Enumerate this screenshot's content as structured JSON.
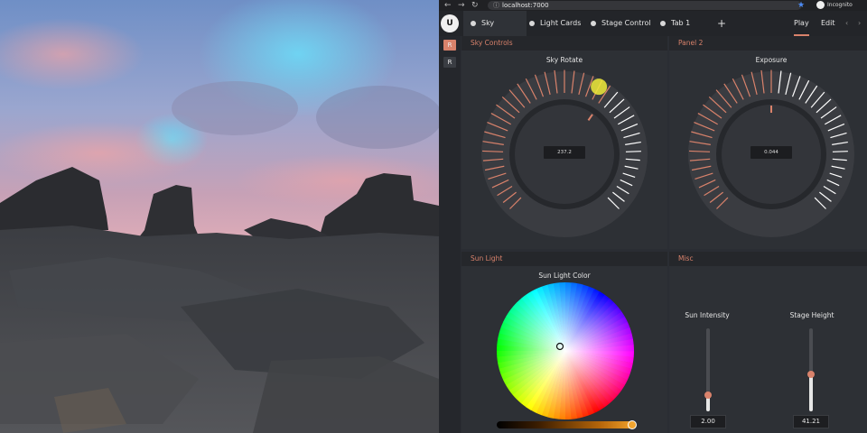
{
  "browser": {
    "url": "localhost:7000",
    "profile": "Incognito"
  },
  "tabs": [
    {
      "label": "Sky",
      "active": true
    },
    {
      "label": "Light Cards",
      "active": false
    },
    {
      "label": "Stage Control",
      "active": false
    },
    {
      "label": "Tab 1",
      "active": false
    }
  ],
  "add_tab_label": "+",
  "modes": {
    "play": "Play",
    "edit": "Edit"
  },
  "logo": "U",
  "sidebar": {
    "buttons": [
      "R",
      "R"
    ]
  },
  "panels": {
    "sky_controls": {
      "title": "Sky Controls",
      "dial": {
        "label": "Sky Rotate",
        "value": "237.2",
        "fraction": 0.63
      }
    },
    "panel2": {
      "title": "Panel 2",
      "dial": {
        "label": "Exposure",
        "value": "0.044",
        "fraction": 0.5
      }
    },
    "sun_light": {
      "title": "Sun Light",
      "color_label": "Sun Light Color",
      "brightness_fraction": 0.98
    },
    "misc": {
      "title": "Misc",
      "sliders": [
        {
          "label": "Sun Intensity",
          "value": "2.00",
          "fraction": 0.2
        },
        {
          "label": "Stage Height",
          "value": "41.21",
          "fraction": 0.45
        }
      ]
    }
  },
  "colors": {
    "accent": "#d9826b",
    "tick_active": "#d9826b",
    "tick_idle": "#ffffff",
    "highlight": "#f0ea3a"
  }
}
